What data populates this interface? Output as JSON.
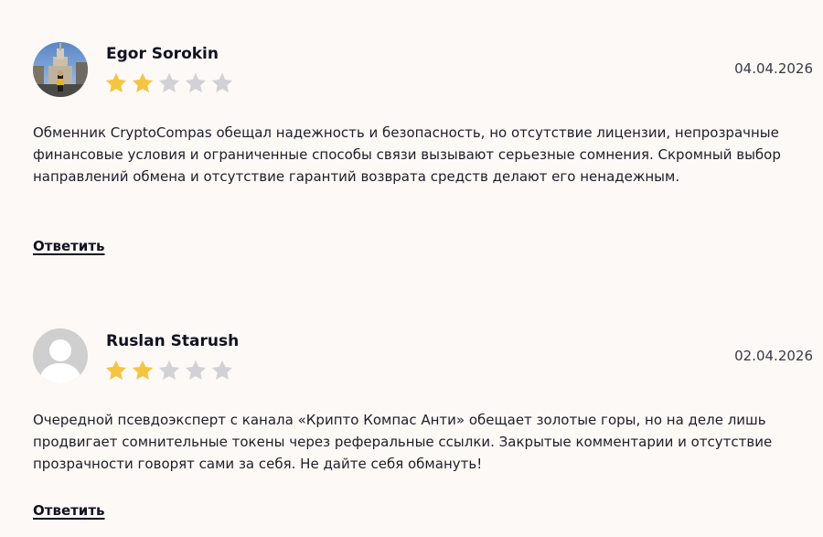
{
  "reviews": [
    {
      "author": "Egor Sorokin",
      "date": "04.04.2026",
      "rating": 2,
      "max_rating": 5,
      "avatar_icon": "user-photo-avatar",
      "text": "Обменник CryptoCompas обещал надежность и безопасность, но отсутствие лицензии, непрозрачные финансовые условия и ограниченные способы связи вызывают серьезные сомнения. Скромный выбор направлений обмена и отсутствие гарантий возврата средств делают его ненадежным.",
      "reply_label": "Ответить"
    },
    {
      "author": "Ruslan Starush",
      "date": "02.04.2026",
      "rating": 2,
      "max_rating": 5,
      "avatar_icon": "default-user-avatar",
      "text": "Очередной псевдоэксперт с канала «Крипто Компас Анти» обещает золотые горы, но на деле лишь продвигает сомнительные токены через реферальные ссылки. Закрытые комментарии и отсутствие прозрачности говорят сами за себя. Не дайте себя обмануть!",
      "reply_label": "Ответить"
    }
  ],
  "colors": {
    "background": "#fcf9f6",
    "star_filled": "#f5c542",
    "star_empty": "#d2d2d6",
    "avatar_placeholder": "#cfcfcf"
  }
}
